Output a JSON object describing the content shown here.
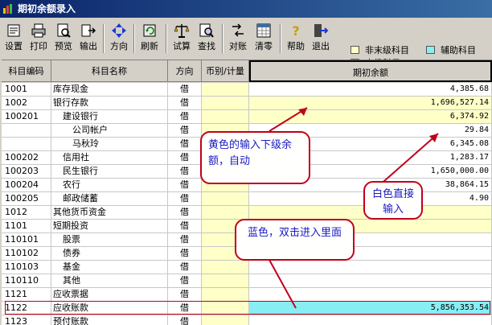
{
  "window": {
    "title": "期初余额录入"
  },
  "toolbar": {
    "buttons": [
      {
        "label": "设置",
        "icon": "settings-icon"
      },
      {
        "label": "打印",
        "icon": "printer-icon"
      },
      {
        "label": "预览",
        "icon": "preview-icon"
      },
      {
        "label": "输出",
        "icon": "export-icon"
      },
      {
        "label": "方向",
        "icon": "direction-icon"
      },
      {
        "label": "刷新",
        "icon": "refresh-icon"
      },
      {
        "label": "试算",
        "icon": "balance-scale-icon"
      },
      {
        "label": "查找",
        "icon": "find-icon"
      },
      {
        "label": "对账",
        "icon": "reconcile-icon"
      },
      {
        "label": "清零",
        "icon": "clear-icon"
      },
      {
        "label": "帮助",
        "icon": "help-icon"
      },
      {
        "label": "退出",
        "icon": "exit-icon"
      }
    ]
  },
  "legend": {
    "non_leaf": "非末级科目",
    "auxiliary": "辅助科目",
    "leaf": "末级科目",
    "colors": {
      "non_leaf": "#ffffc8",
      "auxiliary": "#88eef4",
      "leaf": "#ffffff"
    }
  },
  "table": {
    "headers": {
      "code": "科目编码",
      "name": "科目名称",
      "direction": "方向",
      "currency": "币别/计量",
      "balance": "期初余额"
    },
    "rows": [
      {
        "code": "1001",
        "name": "库存现金",
        "direction": "借",
        "balance": "4,385.68",
        "type": "leaf",
        "indent": 0
      },
      {
        "code": "1002",
        "name": "银行存款",
        "direction": "借",
        "balance": "1,696,527.14",
        "type": "non_leaf",
        "indent": 0
      },
      {
        "code": "100201",
        "name": "建设银行",
        "direction": "借",
        "balance": "6,374.92",
        "type": "non_leaf",
        "indent": 1
      },
      {
        "code": "",
        "name": "公司帐户",
        "direction": "借",
        "balance": "29.84",
        "type": "leaf",
        "indent": 2
      },
      {
        "code": "",
        "name": "马秋玲",
        "direction": "借",
        "balance": "6,345.08",
        "type": "leaf",
        "indent": 2
      },
      {
        "code": "100202",
        "name": "信用社",
        "direction": "借",
        "balance": "1,283.17",
        "type": "leaf",
        "indent": 1
      },
      {
        "code": "100203",
        "name": "民生银行",
        "direction": "借",
        "balance": "1,650,000.00",
        "type": "leaf",
        "indent": 1
      },
      {
        "code": "100204",
        "name": "农行",
        "direction": "借",
        "balance": "38,864.15",
        "type": "leaf",
        "indent": 1
      },
      {
        "code": "100205",
        "name": "邮政储蓄",
        "direction": "借",
        "balance": "4.90",
        "type": "leaf",
        "indent": 1
      },
      {
        "code": "1012",
        "name": "其他货币资金",
        "direction": "借",
        "balance": "",
        "type": "non_leaf",
        "indent": 0
      },
      {
        "code": "1101",
        "name": "短期投资",
        "direction": "借",
        "balance": "",
        "type": "non_leaf",
        "indent": 0
      },
      {
        "code": "110101",
        "name": "股票",
        "direction": "借",
        "balance": "",
        "type": "leaf",
        "indent": 1
      },
      {
        "code": "110102",
        "name": "债券",
        "direction": "借",
        "balance": "",
        "type": "leaf",
        "indent": 1
      },
      {
        "code": "110103",
        "name": "基金",
        "direction": "借",
        "balance": "",
        "type": "leaf",
        "indent": 1
      },
      {
        "code": "110110",
        "name": "其他",
        "direction": "借",
        "balance": "",
        "type": "leaf",
        "indent": 1
      },
      {
        "code": "1121",
        "name": "应收票据",
        "direction": "借",
        "balance": "",
        "type": "leaf",
        "indent": 0
      },
      {
        "code": "1122",
        "name": "应收账款",
        "direction": "借",
        "balance": "5,856,353.54",
        "type": "auxiliary",
        "indent": 0
      },
      {
        "code": "1123",
        "name": "预付账款",
        "direction": "借",
        "balance": "",
        "type": "leaf",
        "indent": 0
      }
    ]
  },
  "annotations": {
    "yellow_note": "黄色的输入下级余额，自动",
    "white_note": "白色直接输入",
    "blue_note": "蓝色，双击进入里面"
  }
}
